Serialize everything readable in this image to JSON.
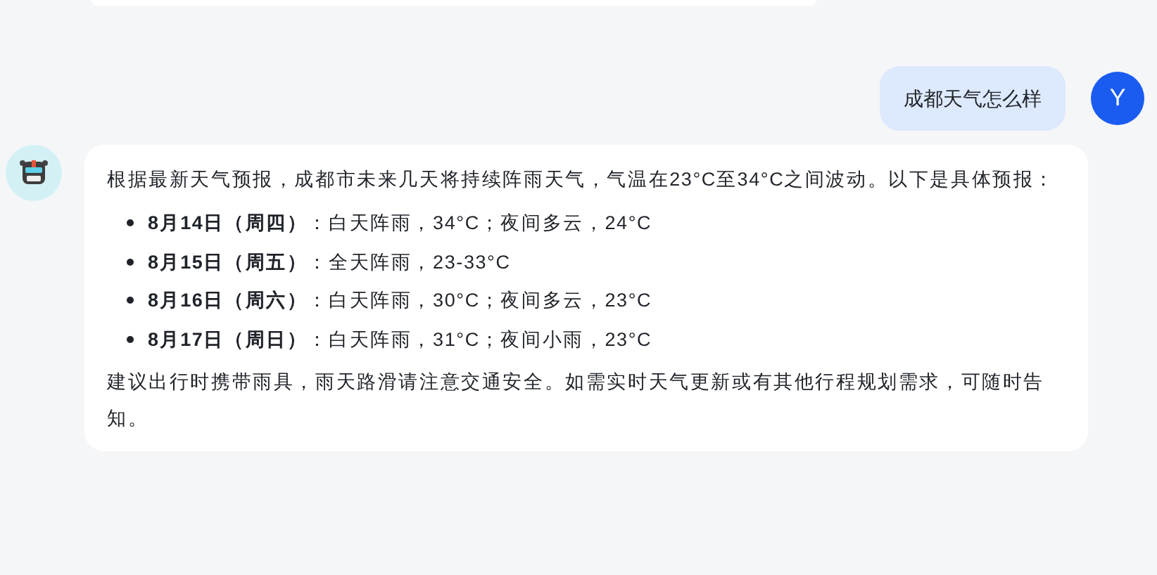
{
  "messages": [
    {
      "kind": "user",
      "avatar": "Y",
      "text": "成都天气怎么样"
    },
    {
      "kind": "assistant",
      "intro": "根据最新天气预报，成都市未来几天将持续阵雨天气，气温在23°C至34°C之间波动。以下是具体预报：",
      "items": [
        "**8月14日（周四）**：白天阵雨，34°C；夜间多云，24°C",
        "**8月15日（周五）**：全天阵雨，23-33°C",
        "**8月16日（周六）**：白天阵雨，30°C；夜间多云，23°C",
        "**8月17日（周日）**：白天阵雨，31°C；夜间小雨，23°C"
      ],
      "outro": "建议出行时携带雨具，雨天路滑请注意交通安全。如需实时天气更新或有其他行程规划需求，可随时告知。"
    }
  ]
}
